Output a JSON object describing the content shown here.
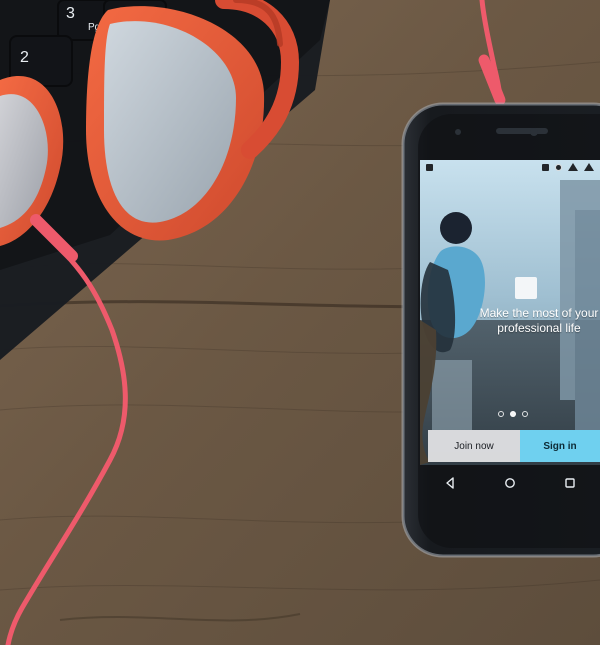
{
  "phone": {
    "screen": {
      "status_icons": [
        "screen-icon",
        "vibrate-icon",
        "alarm-icon",
        "wifi-icon",
        "signal-icon"
      ],
      "headline": "Make the most of your professional life",
      "buttons": {
        "join": "Join now",
        "signin": "Sign in"
      }
    },
    "navbar": {
      "icons": [
        "back-icon",
        "home-icon",
        "recents-icon"
      ]
    }
  },
  "keyboard": {
    "keys": [
      "3",
      "Pg Dn",
      "2"
    ]
  },
  "colors": {
    "table_wood": "#6d5a47",
    "headphones_red": "#e35a3a",
    "headphones_cushion": "#b7c0c9",
    "cable_pink": "#ee5a6b",
    "signin_blue": "#6fd0ef"
  }
}
